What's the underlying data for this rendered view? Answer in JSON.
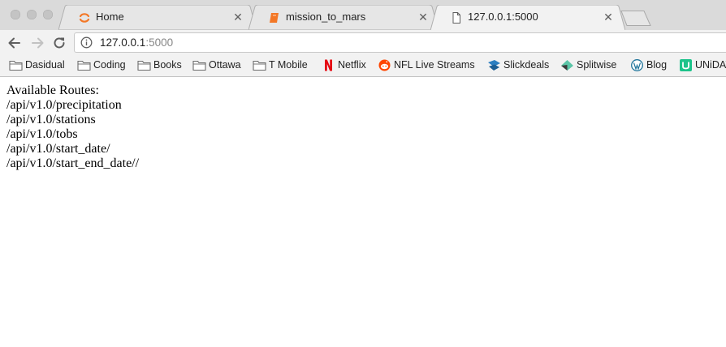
{
  "browser": {
    "tabs": [
      {
        "title": "Home",
        "favicon": "orange-ring-icon",
        "active": false
      },
      {
        "title": "mission_to_mars",
        "favicon": "orange-notebook-icon",
        "active": false
      },
      {
        "title": "127.0.0.1:5000",
        "favicon": "page-icon",
        "active": true
      }
    ],
    "address": {
      "host": "127.0.0.1",
      "port": ":5000"
    },
    "bookmarks": [
      {
        "label": "Dasidual",
        "icon": "folder-icon"
      },
      {
        "label": "Coding",
        "icon": "folder-icon"
      },
      {
        "label": "Books",
        "icon": "folder-icon"
      },
      {
        "label": "Ottawa",
        "icon": "folder-icon"
      },
      {
        "label": "T Mobile",
        "icon": "folder-icon"
      },
      {
        "label": "Netflix",
        "icon": "netflix-icon"
      },
      {
        "label": "NFL Live Streams",
        "icon": "reddit-icon"
      },
      {
        "label": "Slickdeals",
        "icon": "slickdeals-icon"
      },
      {
        "label": "Splitwise",
        "icon": "splitwise-icon"
      },
      {
        "label": "Blog",
        "icon": "wordpress-icon"
      },
      {
        "label": "UNiDAY",
        "icon": "unidays-icon"
      }
    ]
  },
  "page": {
    "heading": "Available Routes:",
    "routes": [
      "/api/v1.0/precipitation",
      "/api/v1.0/stations",
      "/api/v1.0/tobs",
      "/api/v1.0/start_date/",
      "/api/v1.0/start_end_date//"
    ]
  },
  "colors": {
    "tab_strip": "#dadada",
    "toolbar": "#f2f2f2",
    "accent_orange": "#f37726",
    "netflix_red": "#e50914",
    "reddit_orange": "#ff4500"
  }
}
